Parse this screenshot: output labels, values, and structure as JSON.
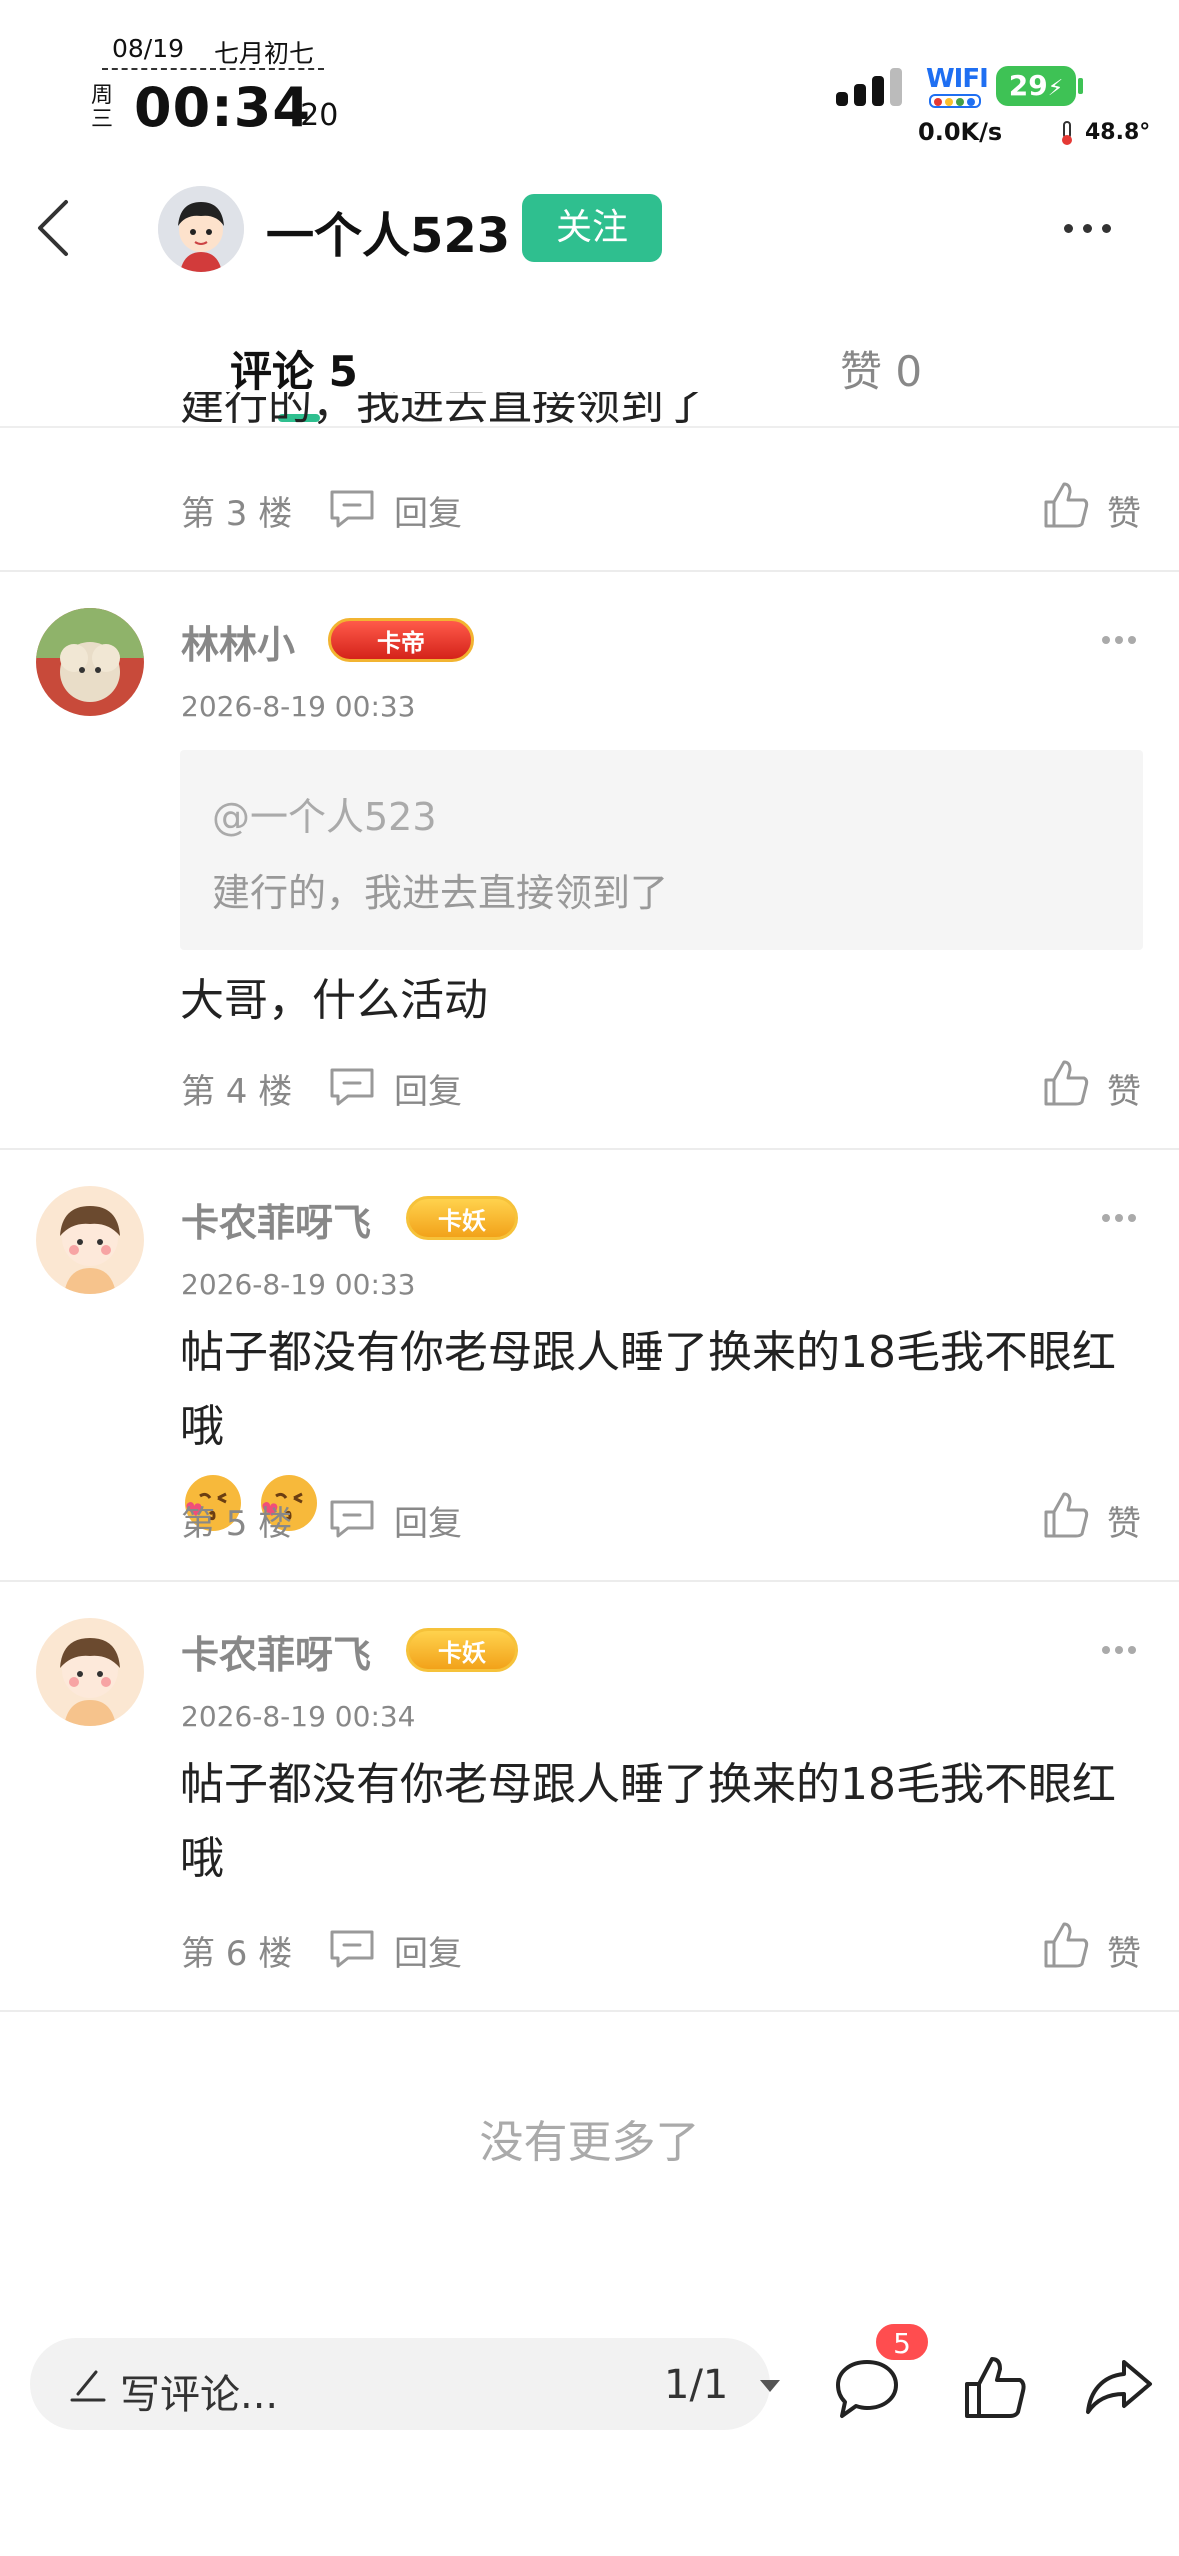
{
  "status_bar": {
    "date": "08/19",
    "lunar": "七月初七",
    "weekday": "周三",
    "time": "00:34",
    "seconds": ":20",
    "wifi_label": "WIFI",
    "battery": "29",
    "speed": "0.0K/s",
    "temperature": "48.8°"
  },
  "header": {
    "name": "一个人523",
    "follow_label": "关注"
  },
  "tabs": [
    {
      "label": "评论 5",
      "active": true
    },
    {
      "label": "赞 0",
      "active": false
    }
  ],
  "cutoff_text": "建行的，我进去直接领到了",
  "comments": [
    {
      "floor": "第 3 楼",
      "reply_label": "回复",
      "like_label": "赞"
    },
    {
      "username": "林林小",
      "badge": "卡帝",
      "time": "2026-8-19 00:33",
      "quote_at": "@一个人523",
      "quote_text": "建行的，我进去直接领到了",
      "text": "大哥，什么活动",
      "floor": "第 4 楼",
      "reply_label": "回复",
      "like_label": "赞"
    },
    {
      "username": "卡农菲呀飞",
      "badge": "卡妖",
      "time": "2026-8-19 00:33",
      "text": "帖子都没有你老母跟人睡了换来的18毛我不眼红哦",
      "emojis": [
        "kissing-face-emoji",
        "kissing-face-emoji"
      ],
      "floor": "第 5 楼",
      "reply_label": "回复",
      "like_label": "赞"
    },
    {
      "username": "卡农菲呀飞",
      "badge": "卡妖",
      "time": "2026-8-19 00:34",
      "text": "帖子都没有你老母跟人睡了换来的18毛我不眼红哦",
      "floor": "第 6 楼",
      "reply_label": "回复",
      "like_label": "赞"
    }
  ],
  "no_more": "没有更多了",
  "bottom_bar": {
    "placeholder": "写评论...",
    "page": "1/1",
    "comment_count": "5"
  },
  "colors": {
    "accent": "#2fbf8f",
    "badge_red": "#ff4d4f",
    "battery": "#3ec255",
    "wifi": "#1f6ff2"
  }
}
